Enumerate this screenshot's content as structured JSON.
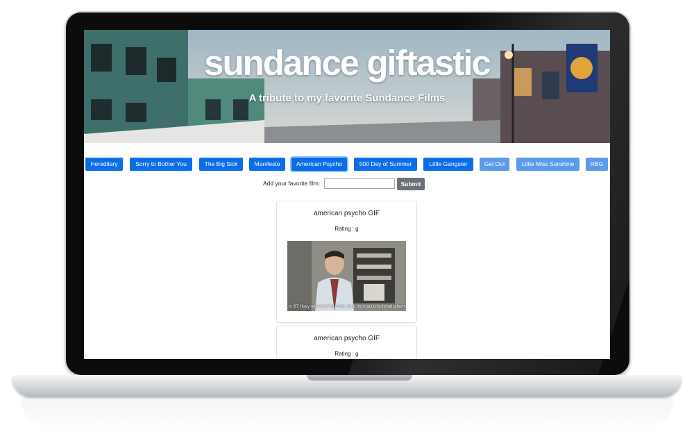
{
  "hero": {
    "title": "sundance giftastic",
    "subtitle": "A tribute to my favorite Sundance Films"
  },
  "films": [
    {
      "label": "Hereditary"
    },
    {
      "label": "Sorry to Bother You"
    },
    {
      "label": "The Big Sick"
    },
    {
      "label": "Manifesto"
    },
    {
      "label": "American Psycho"
    },
    {
      "label": "500 Day of Summer"
    },
    {
      "label": "Little Gangster"
    },
    {
      "label": "Get Out"
    },
    {
      "label": "Little Miss Sunshine"
    },
    {
      "label": "RBG"
    }
  ],
  "form": {
    "label": "Add your favorite film:",
    "input_value": "",
    "submit_label": "Submit"
  },
  "gifs": [
    {
      "title": "american psycho GIF",
      "rating": "Rating : g",
      "caption": "In '87 Huey released this, Fore, their most accomplished album"
    },
    {
      "title": "american psycho GIF",
      "rating": "Rating : g"
    }
  ],
  "colors": {
    "button_primary": "#0b6ee8",
    "button_light": "#5a9bec",
    "submit": "#6b7078"
  }
}
